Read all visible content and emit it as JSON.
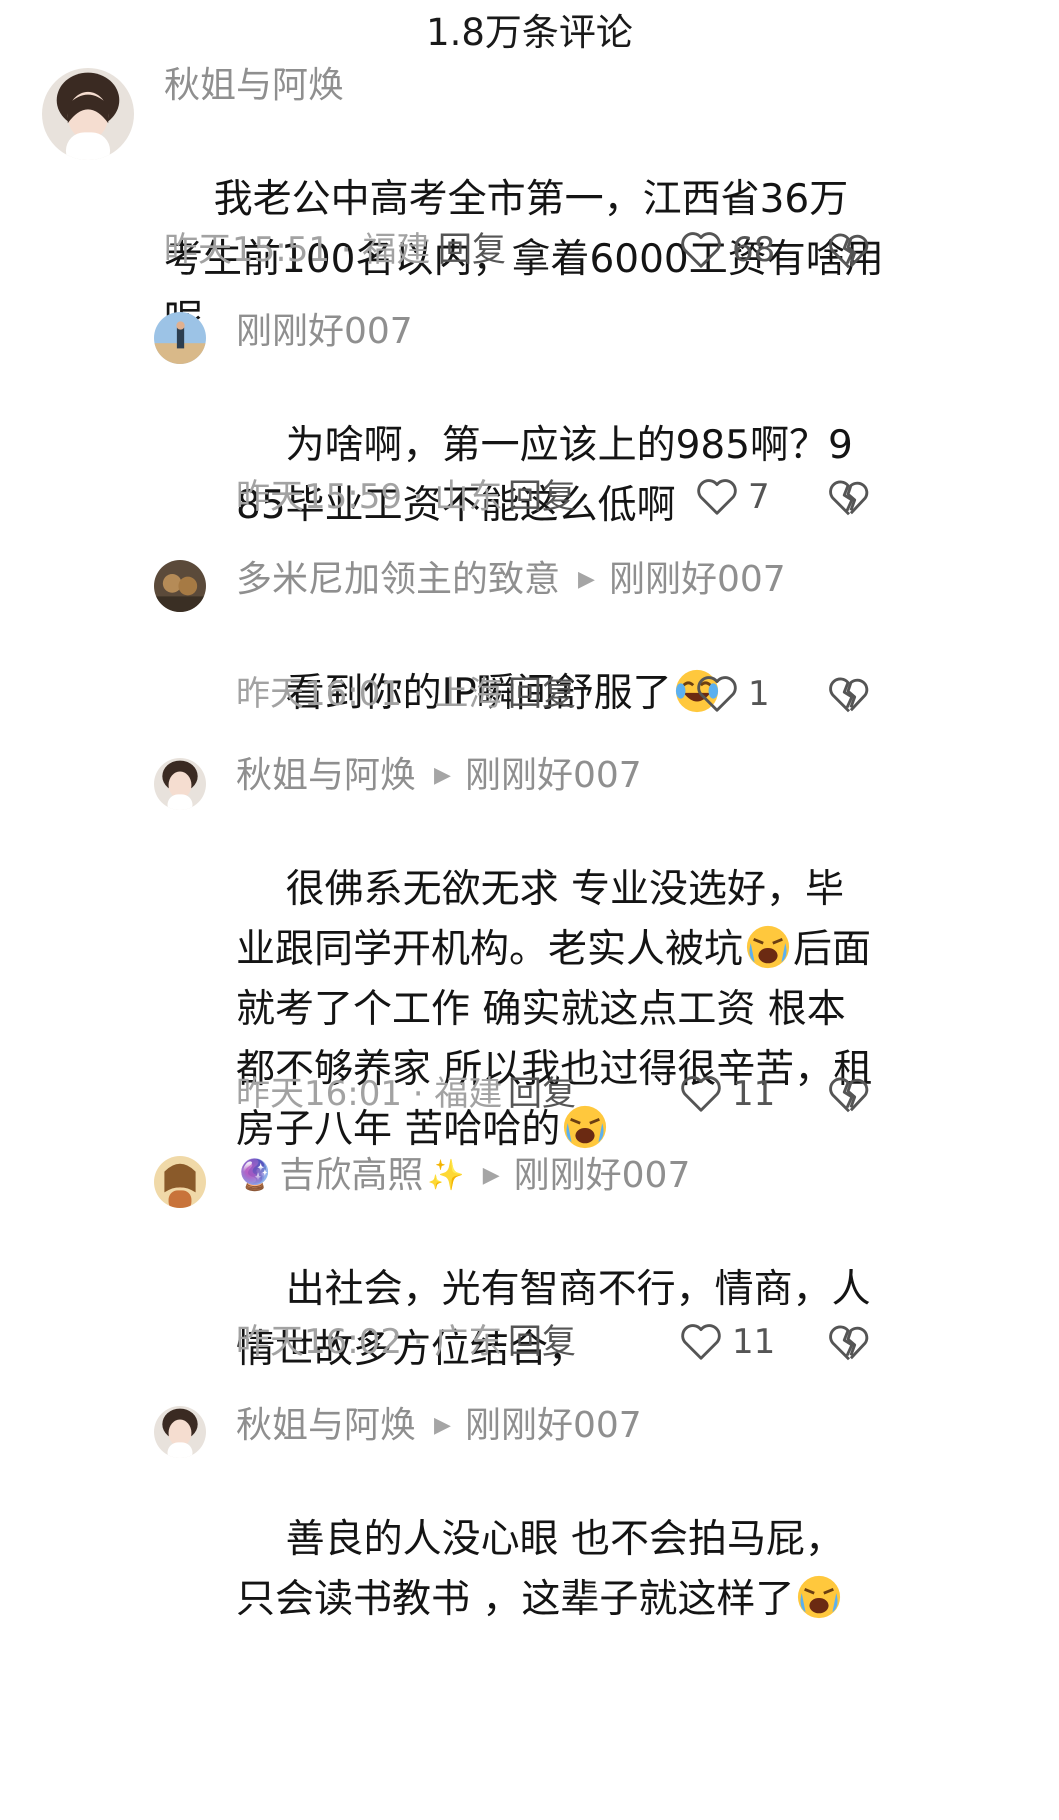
{
  "header": {
    "title": "1.8万条评论"
  },
  "comments": [
    {
      "name": "秋姐与阿焕",
      "text": "我老公中高考全市第一，江西省36万考生前100名以内，拿着6000工资有啥用呢",
      "meta": "昨天15:51 · 福建",
      "reply": "回复",
      "likes": "68"
    },
    {
      "name": "刚刚好007",
      "text": "为啥啊，第一应该上的985啊？985毕业工资不能这么低啊",
      "meta": "昨天15:59 · 山东",
      "reply": "回复",
      "likes": "7"
    },
    {
      "name": "多米尼加领主的致意",
      "reply_to": "刚刚好007",
      "text": "看到你的IP瞬间舒服了",
      "emoji": "laugh-cry-emoji",
      "meta": "昨天16:01 · 上海",
      "reply": "回复",
      "likes": "1"
    },
    {
      "name": "秋姐与阿焕",
      "reply_to": "刚刚好007",
      "text_a": "很佛系无欲无求 专业没选好，毕业跟同学开机构。老实人被坑",
      "text_b": "后面就考了个工作 确实就这点工资 根本都不够养家 所以我也过得很辛苦，租房子八年 苦哈哈的",
      "emoji": "cry-emoji",
      "meta": "昨天16:01 · 福建",
      "reply": "回复",
      "likes": "11"
    },
    {
      "name": "吉欣高照",
      "reply_to": "刚刚好007",
      "text": "出社会，光有智商不行，情商，人情世故多方位结合，",
      "meta": "昨天16:02 · 广东",
      "reply": "回复",
      "likes": "11"
    },
    {
      "name": "秋姐与阿焕",
      "reply_to": "刚刚好007",
      "text": "善良的人没心眼 也不会拍马屁，只会读书教书 ，这辈子就这样了",
      "emoji": "cry-emoji"
    }
  ],
  "colors": {
    "name": "#8f8f8f",
    "text": "#141414",
    "meta": "#a2a2a2",
    "action": "#555555"
  },
  "icons": {
    "like": "heart-outline-icon",
    "dislike": "broken-heart-icon"
  }
}
